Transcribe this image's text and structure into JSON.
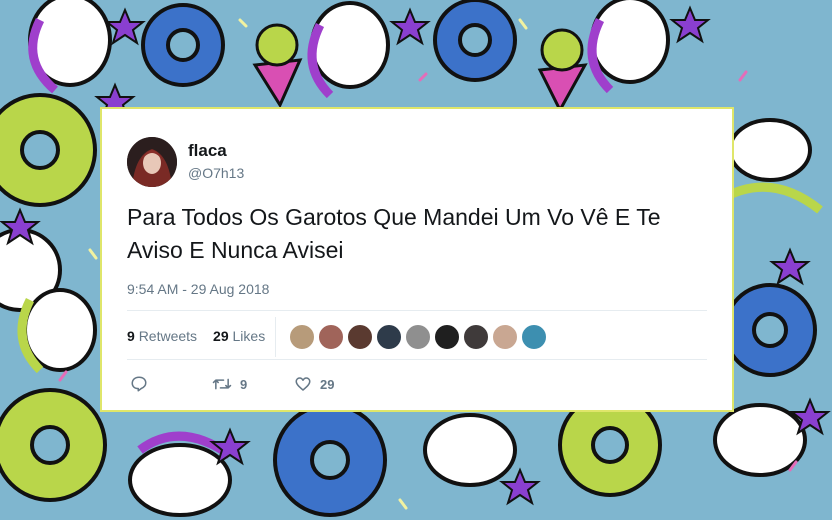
{
  "tweet": {
    "name": "flaca",
    "handle": "@O7h13",
    "text": "Para Todos Os Garotos Que Mandei Um Vo Vê E Te Aviso E Nunca Avisei",
    "timestamp": "9:54 AM - 29 Aug 2018",
    "retweets_count": "9",
    "retweets_label": "Retweets",
    "likes_count": "29",
    "likes_label": "Likes",
    "action_retweet_count": "9",
    "action_like_count": "29"
  },
  "icons": {
    "reply": "reply-icon",
    "retweet": "retweet-icon",
    "like": "heart-icon"
  },
  "colors": {
    "background": "#7fb6cf",
    "card": "#ffffff",
    "card_border": "#dfe66a",
    "text": "#14171a",
    "muted": "#657786"
  }
}
